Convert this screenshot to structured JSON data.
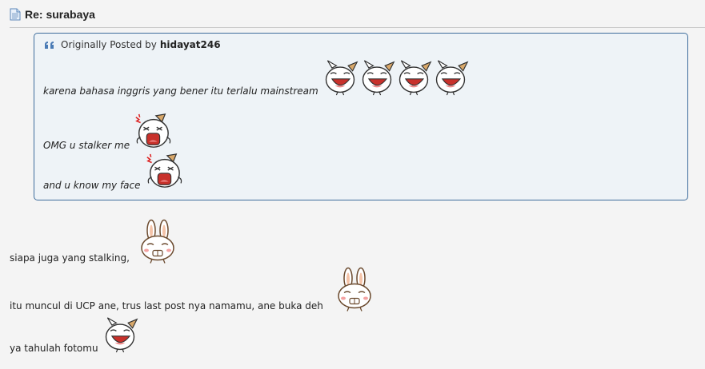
{
  "post": {
    "title": "Re: surabaya"
  },
  "quote": {
    "prefix": "Originally Posted by",
    "author": "hidayat246",
    "lines": [
      "karena bahasa inggris yang bener itu terlalu mainstream",
      "OMG u stalker me",
      "and u know my face"
    ]
  },
  "body": {
    "lines": [
      "siapa juga yang stalking,",
      "itu muncul di UCP ane, trus last post nya namamu, ane buka deh",
      "ya tahulah fotomu"
    ]
  },
  "icons": {
    "title": "document-icon",
    "quote": "quote-icon",
    "smiley_laugh": "laughing-cat-smiley-icon",
    "smiley_angry": "shouting-face-smiley-icon",
    "smiley_bunny": "grinning-bunny-smiley-icon"
  },
  "colors": {
    "quote_border": "#3e6d9c",
    "quote_background": "#eef3f7",
    "page_background": "#f4f4f4"
  }
}
